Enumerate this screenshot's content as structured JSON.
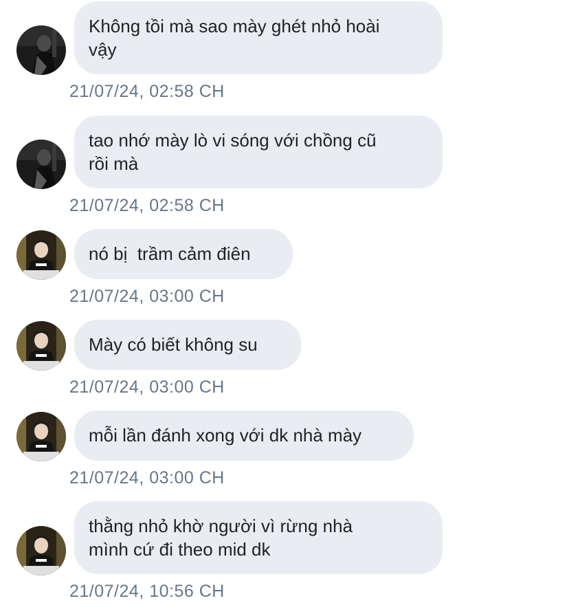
{
  "messages": [
    {
      "text": "Không tồi mà sao mày ghét nhỏ hoài\nvậy",
      "timestamp": "21/07/24, 02:58 CH",
      "avatar": "dark-portrait-avatar"
    },
    {
      "text": "tao nhớ mày lò vi sóng với chồng cũ\nrồi mà",
      "timestamp": "21/07/24, 02:58 CH",
      "avatar": "dark-portrait-avatar"
    },
    {
      "text": "nó bị  trầm cảm điên",
      "timestamp": "21/07/24, 03:00 CH",
      "avatar": "gamer-portrait-avatar"
    },
    {
      "text": "Mày có biết không su",
      "timestamp": "21/07/24, 03:00 CH",
      "avatar": "gamer-portrait-avatar"
    },
    {
      "text": "mỗi lần đánh xong với dk nhà mày",
      "timestamp": "21/07/24, 03:00 CH",
      "avatar": "gamer-portrait-avatar"
    },
    {
      "text": "thằng nhỏ khờ người vì rừng nhà\nmình cứ đi theo mid dk",
      "timestamp": "21/07/24, 10:56 CH",
      "avatar": "gamer-portrait-avatar"
    }
  ],
  "colors": {
    "bubble_background": "#e9edf2",
    "message_text": "#1f2124",
    "timestamp_text": "#66768a"
  }
}
